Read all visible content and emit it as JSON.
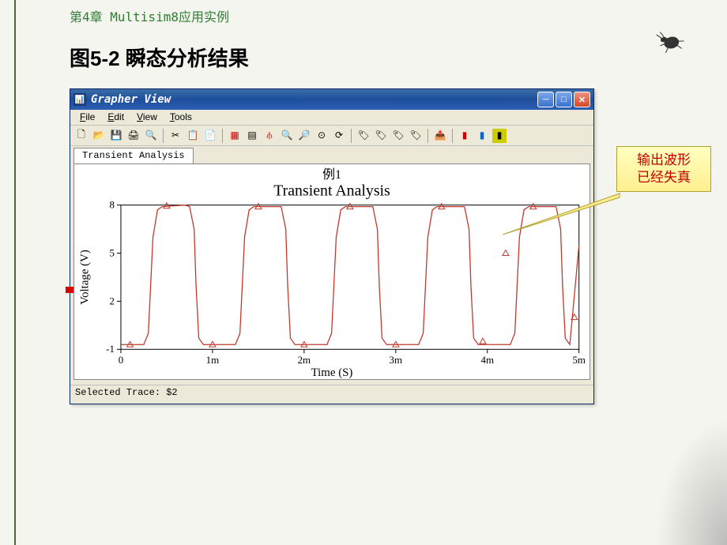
{
  "page": {
    "chapter_title": "第4章  Multisim8应用实例",
    "figure_title": "图5-2 瞬态分析结果"
  },
  "window": {
    "title": "Grapher View",
    "menus": [
      "File",
      "Edit",
      "View",
      "Tools"
    ],
    "tab_label": "Transient Analysis",
    "status_text": "Selected Trace:  $2"
  },
  "toolbar_icons": [
    "new",
    "open",
    "save",
    "print",
    "preview",
    "sep",
    "cut",
    "copy",
    "paste",
    "sep",
    "grid",
    "legend",
    "cursors",
    "zoomin",
    "zoomout",
    "zoomfit",
    "restore",
    "sep",
    "marker1",
    "marker2",
    "marker3",
    "marker4",
    "sep",
    "export",
    "sep",
    "opt1",
    "opt2",
    "opt3"
  ],
  "callout": {
    "text": "输出波形\n已经失真"
  },
  "chart_data": {
    "type": "line",
    "title_top": "例1",
    "title": "Transient Analysis",
    "xlabel": "Time (S)",
    "ylabel": "Voltage (V)",
    "xticks": [
      "0",
      "1m",
      "2m",
      "3m",
      "4m",
      "5m"
    ],
    "yticks": [
      -1,
      2,
      5,
      8
    ],
    "xlim": [
      0,
      0.005
    ],
    "ylim": [
      -1,
      8
    ],
    "series": [
      {
        "name": "$2",
        "color": "#c0392b",
        "data": [
          [
            0.0,
            -0.7
          ],
          [
            0.00025,
            -0.7
          ],
          [
            0.0003,
            0.0
          ],
          [
            0.00035,
            6.0
          ],
          [
            0.0004,
            7.7
          ],
          [
            0.00045,
            7.9
          ],
          [
            0.0007,
            8.0
          ],
          [
            0.00075,
            7.9
          ],
          [
            0.0008,
            6.5
          ],
          [
            0.00082,
            3.0
          ],
          [
            0.00085,
            -0.3
          ],
          [
            0.0009,
            -0.7
          ],
          [
            0.00125,
            -0.7
          ],
          [
            0.0013,
            0.0
          ],
          [
            0.00135,
            6.0
          ],
          [
            0.0014,
            7.7
          ],
          [
            0.00145,
            7.9
          ],
          [
            0.0017,
            7.9
          ],
          [
            0.00175,
            7.9
          ],
          [
            0.0018,
            6.5
          ],
          [
            0.00182,
            3.0
          ],
          [
            0.00185,
            -0.3
          ],
          [
            0.0019,
            -0.7
          ],
          [
            0.00225,
            -0.7
          ],
          [
            0.0023,
            0.0
          ],
          [
            0.00235,
            6.0
          ],
          [
            0.0024,
            7.7
          ],
          [
            0.00245,
            7.9
          ],
          [
            0.0027,
            7.9
          ],
          [
            0.00275,
            7.9
          ],
          [
            0.0028,
            6.5
          ],
          [
            0.00282,
            3.0
          ],
          [
            0.00285,
            -0.3
          ],
          [
            0.0029,
            -0.7
          ],
          [
            0.00325,
            -0.7
          ],
          [
            0.0033,
            0.0
          ],
          [
            0.00335,
            6.0
          ],
          [
            0.0034,
            7.7
          ],
          [
            0.00345,
            7.9
          ],
          [
            0.0037,
            7.9
          ],
          [
            0.00375,
            7.9
          ],
          [
            0.0038,
            6.5
          ],
          [
            0.00382,
            3.0
          ],
          [
            0.00385,
            -0.3
          ],
          [
            0.0039,
            -0.7
          ],
          [
            0.00425,
            -0.7
          ],
          [
            0.0043,
            0.0
          ],
          [
            0.00435,
            6.0
          ],
          [
            0.0044,
            7.7
          ],
          [
            0.00445,
            7.9
          ],
          [
            0.0047,
            7.9
          ],
          [
            0.00475,
            7.9
          ],
          [
            0.0048,
            6.5
          ],
          [
            0.00482,
            3.0
          ],
          [
            0.00485,
            -0.3
          ],
          [
            0.0049,
            -0.7
          ],
          [
            0.005,
            5.5
          ]
        ],
        "markers": [
          [
            0.0001,
            -0.7
          ],
          [
            0.0005,
            7.95
          ],
          [
            0.001,
            -0.7
          ],
          [
            0.0015,
            7.9
          ],
          [
            0.002,
            -0.7
          ],
          [
            0.0025,
            7.9
          ],
          [
            0.003,
            -0.7
          ],
          [
            0.0035,
            7.9
          ],
          [
            0.00395,
            -0.5
          ],
          [
            0.0042,
            5.0
          ],
          [
            0.0045,
            7.9
          ],
          [
            0.00495,
            1.0
          ]
        ]
      }
    ]
  }
}
